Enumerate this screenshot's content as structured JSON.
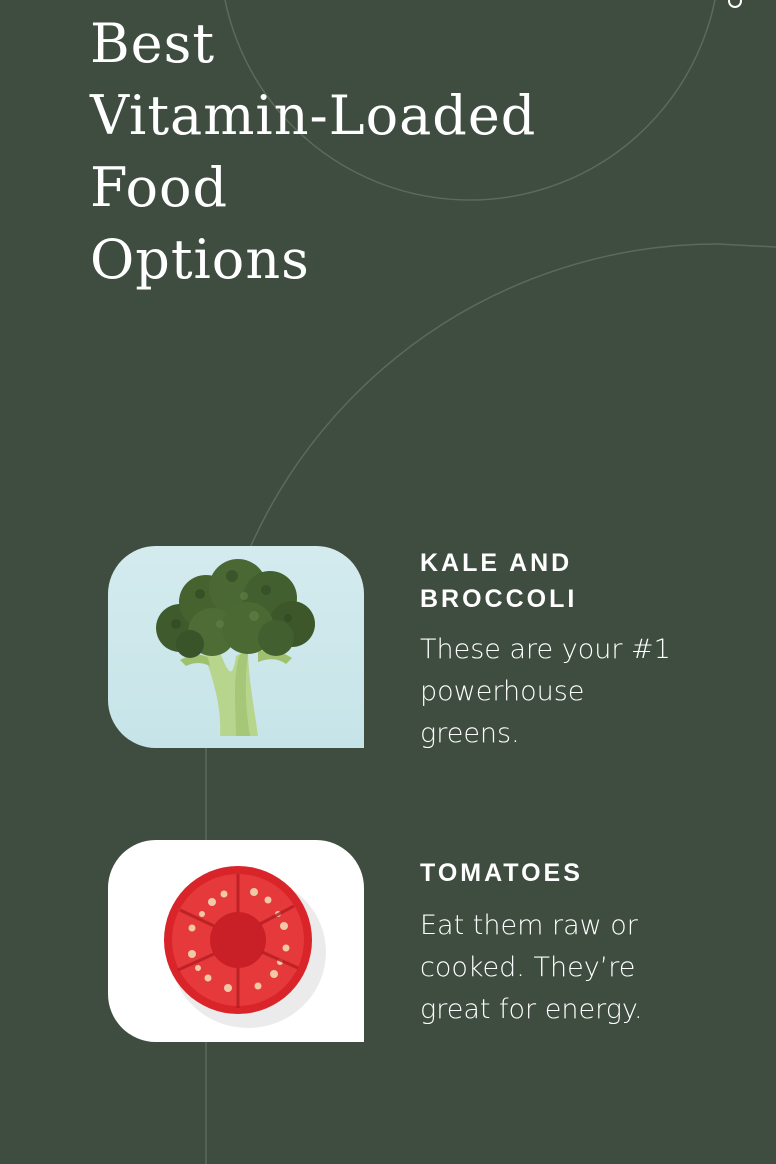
{
  "header": {
    "corner_icon": "ring-icon",
    "title_lines": [
      "Best",
      "Vitamin-Loaded",
      "Food",
      "Options"
    ]
  },
  "foods": [
    {
      "heading_lines": [
        "KALE AND",
        "BROCCOLI"
      ],
      "description": "These are your #1 powerhouse greens.",
      "image": "broccoli-photo"
    },
    {
      "heading_lines": [
        "TOMATOES"
      ],
      "description": "Eat them raw or cooked. They’re great for energy.",
      "image": "tomato-photo"
    }
  ],
  "colors": {
    "background": "#3f4d41",
    "text": "#ffffff",
    "decorative_line": "#5b6a5c"
  }
}
